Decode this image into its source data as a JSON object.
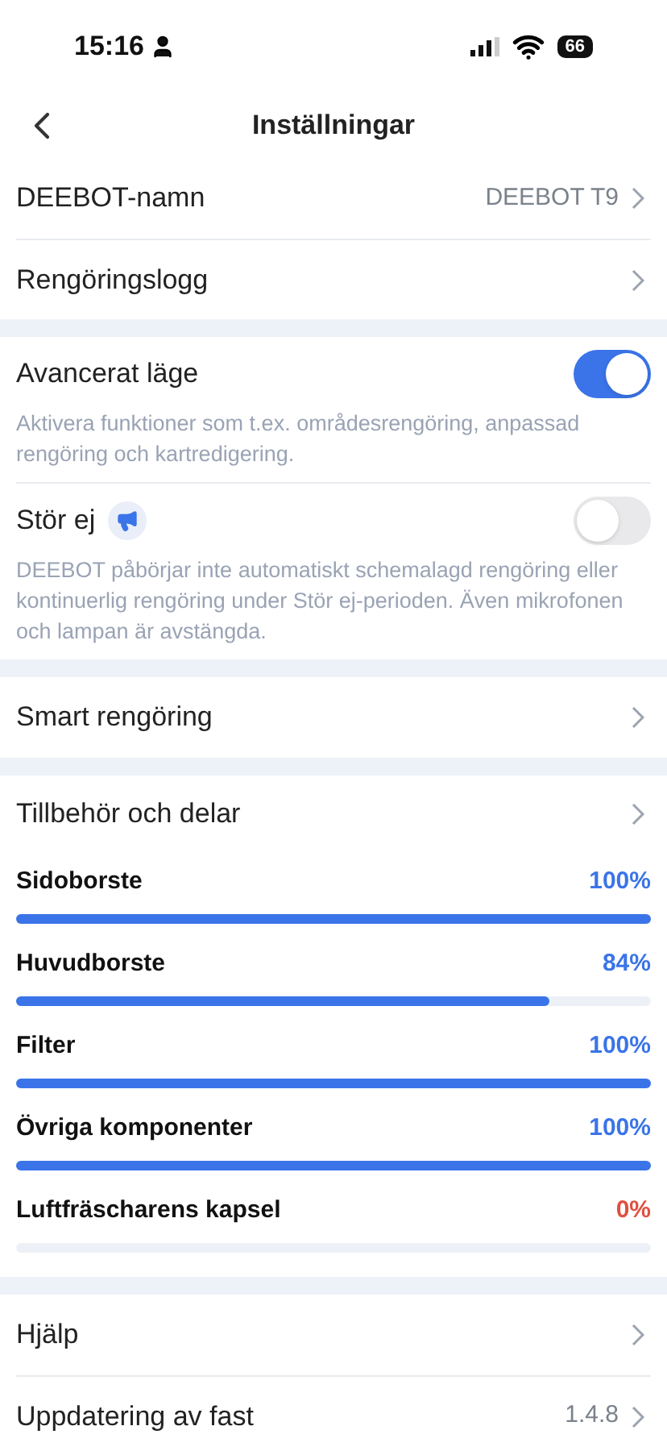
{
  "status_bar": {
    "time": "15:16",
    "battery": "66"
  },
  "header": {
    "title": "Inställningar"
  },
  "sections": [
    {
      "kind": "list",
      "items": [
        {
          "label": "DEEBOT-namn",
          "value": "DEEBOT T9"
        },
        {
          "label": "Rengöringslogg"
        }
      ]
    },
    {
      "kind": "toggles",
      "items": [
        {
          "label": "Avancerat läge",
          "on": true,
          "has_icon": false,
          "description": "Aktivera funktioner som t.ex. områdesrengöring, anpassad rengöring och kartredigering."
        },
        {
          "label": "Stör ej",
          "on": false,
          "has_icon": true,
          "description": "DEEBOT påbörjar inte automatiskt schemalagd rengöring eller kontinuerlig rengöring under Stör ej-perioden.  Även mikrofonen och lampan är avstängda."
        }
      ]
    },
    {
      "kind": "list",
      "items": [
        {
          "label": "Smart rengöring"
        }
      ]
    },
    {
      "kind": "parts",
      "title": "Tillbehör och delar",
      "items": [
        {
          "name": "Sidoborste",
          "reading": "100%",
          "level": 1,
          "warning": false
        },
        {
          "name": "Huvudborste",
          "reading": "84%",
          "level": 0.84,
          "warning": false
        },
        {
          "name": "Filter",
          "reading": "100%",
          "level": 1,
          "warning": false
        },
        {
          "name": "Övriga komponenter",
          "reading": "100%",
          "level": 1,
          "warning": false
        },
        {
          "name": "Luftfräscharens kapsel",
          "reading": "0%",
          "level": 0,
          "warning": true
        }
      ]
    },
    {
      "kind": "list",
      "items": [
        {
          "label": "Hjälp"
        },
        {
          "label": "Uppdatering av fast",
          "value": "1.4.8"
        }
      ]
    }
  ]
}
